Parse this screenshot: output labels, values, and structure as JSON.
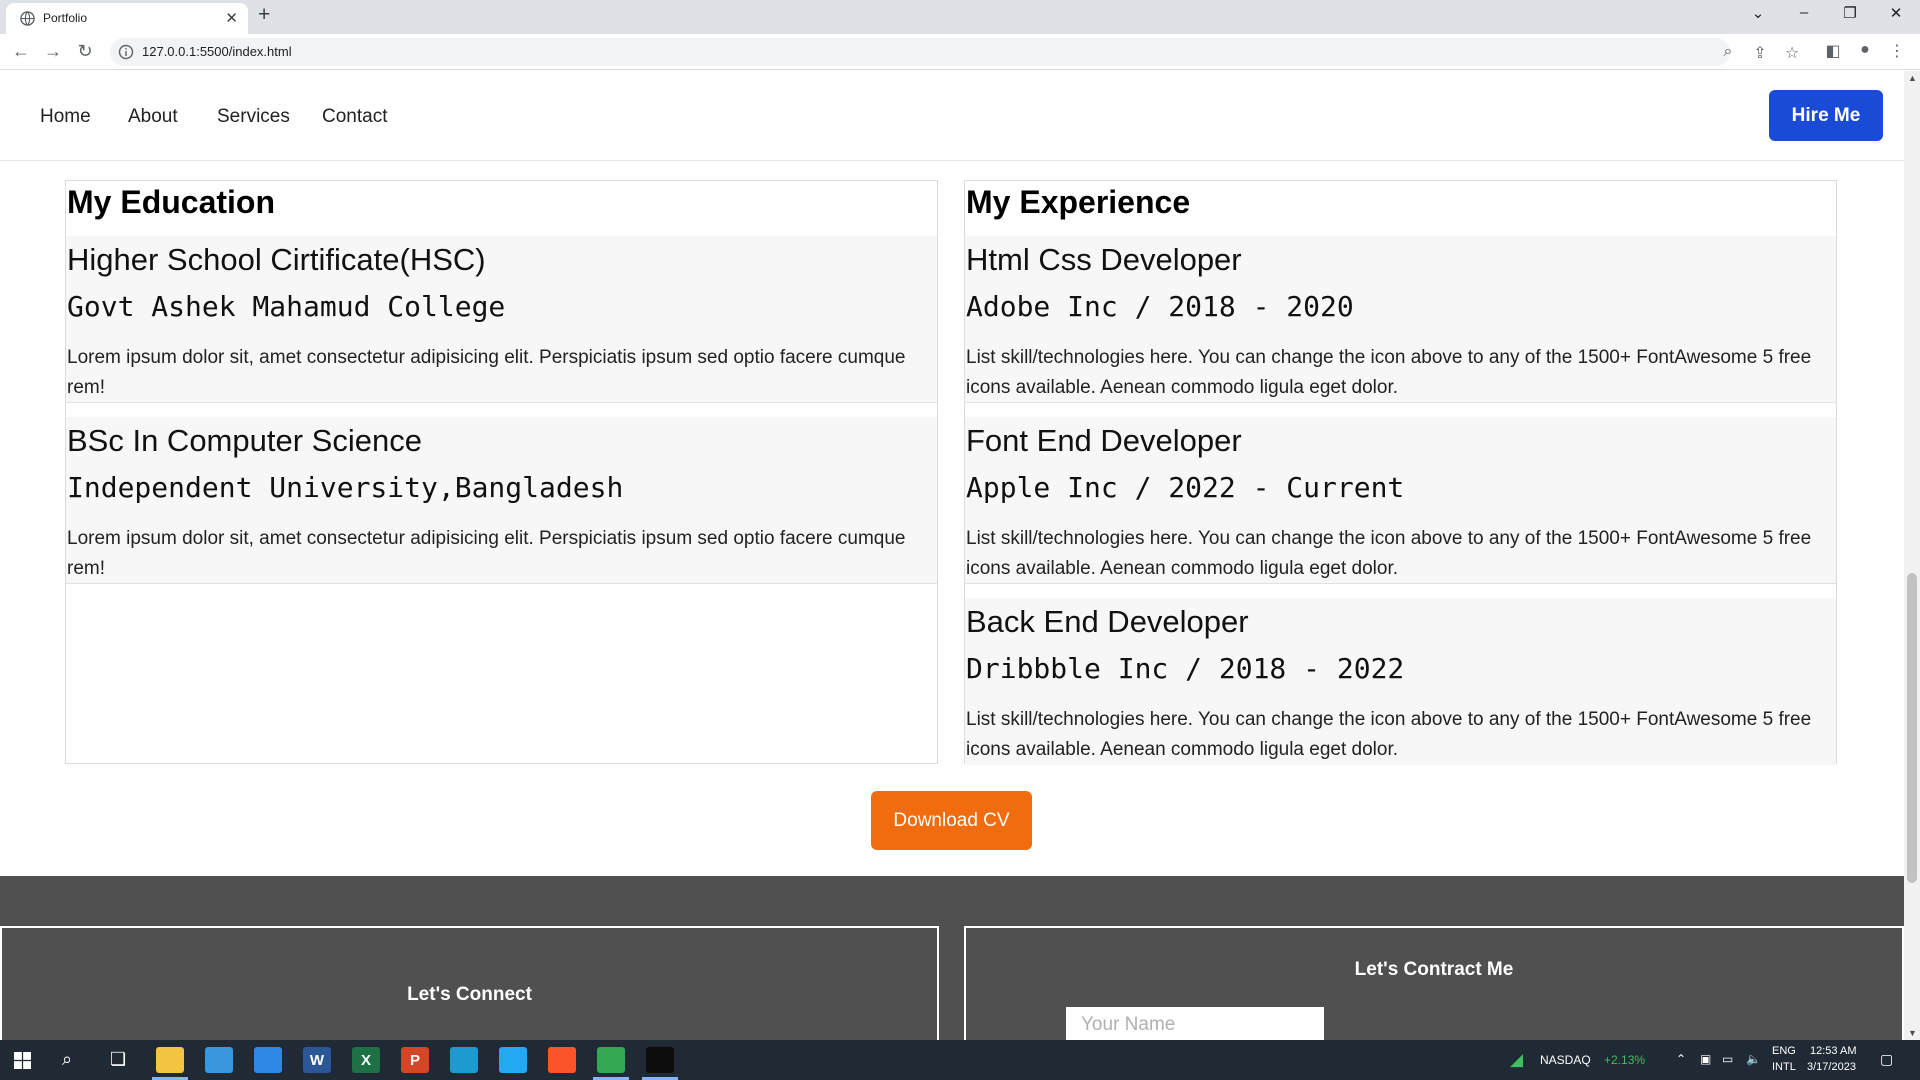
{
  "browser": {
    "tab_title": "Portfolio",
    "new_tab": "+",
    "url": "127.0.0.1:5500/index.html"
  },
  "nav": {
    "links": [
      "Home",
      "About",
      "Services",
      "Contact"
    ],
    "hire_button": "Hire Me"
  },
  "education": {
    "title": "My Education",
    "items": [
      {
        "title": "Higher School Cirtificate(HSC)",
        "sub": "Govt Ashek Mahamud College",
        "desc": "Lorem ipsum dolor sit, amet consectetur adipisicing elit. Perspiciatis ipsum sed optio facere cumque rem!"
      },
      {
        "title": "BSc In Computer Science",
        "sub": "Independent University,Bangladesh",
        "desc": "Lorem ipsum dolor sit, amet consectetur adipisicing elit. Perspiciatis ipsum sed optio facere cumque rem!"
      }
    ]
  },
  "experience": {
    "title": "My Experience",
    "items": [
      {
        "title": "Html Css Developer",
        "sub": "Adobe Inc / 2018 - 2020",
        "desc": "List skill/technologies here. You can change the icon above to any of the 1500+ FontAwesome 5 free icons available. Aenean commodo ligula eget dolor."
      },
      {
        "title": "Font End Developer",
        "sub": "Apple Inc / 2022 - Current",
        "desc": "List skill/technologies here. You can change the icon above to any of the 1500+ FontAwesome 5 free icons available. Aenean commodo ligula eget dolor."
      },
      {
        "title": "Back End Developer",
        "sub": "Dribbble Inc / 2018 - 2022",
        "desc": "List skill/technologies here. You can change the icon above to any of the 1500+ FontAwesome 5 free icons available. Aenean commodo ligula eget dolor."
      }
    ]
  },
  "download_button": "Download CV",
  "footer": {
    "connect_title": "Let's Connect",
    "contract_title": "Let's Contract Me",
    "name_placeholder": "Your Name"
  },
  "taskbar": {
    "apps": [
      {
        "icon": "file-explorer-icon",
        "color": "#f4c542"
      },
      {
        "icon": "store-icon",
        "color": "#3a96dd"
      },
      {
        "icon": "mail-icon",
        "color": "#2f88e6"
      },
      {
        "icon": "word-icon",
        "color": "#2b5797",
        "glyph": "W"
      },
      {
        "icon": "excel-icon",
        "color": "#1e7145",
        "glyph": "X"
      },
      {
        "icon": "powerpoint-icon",
        "color": "#d24726",
        "glyph": "P"
      },
      {
        "icon": "edge-icon",
        "color": "#1d9bd1"
      },
      {
        "icon": "vscode-icon",
        "color": "#23a9f2"
      },
      {
        "icon": "brave-icon",
        "color": "#fb542b"
      },
      {
        "icon": "chrome-icon",
        "color": "#34a853"
      },
      {
        "icon": "terminal-icon",
        "color": "#0c0c0c"
      }
    ],
    "stock_name": "NASDAQ",
    "stock_change": "+2.13%",
    "lang_top": "ENG",
    "lang_bottom": "INTL",
    "time": "12:53 AM",
    "date": "3/17/2023"
  }
}
